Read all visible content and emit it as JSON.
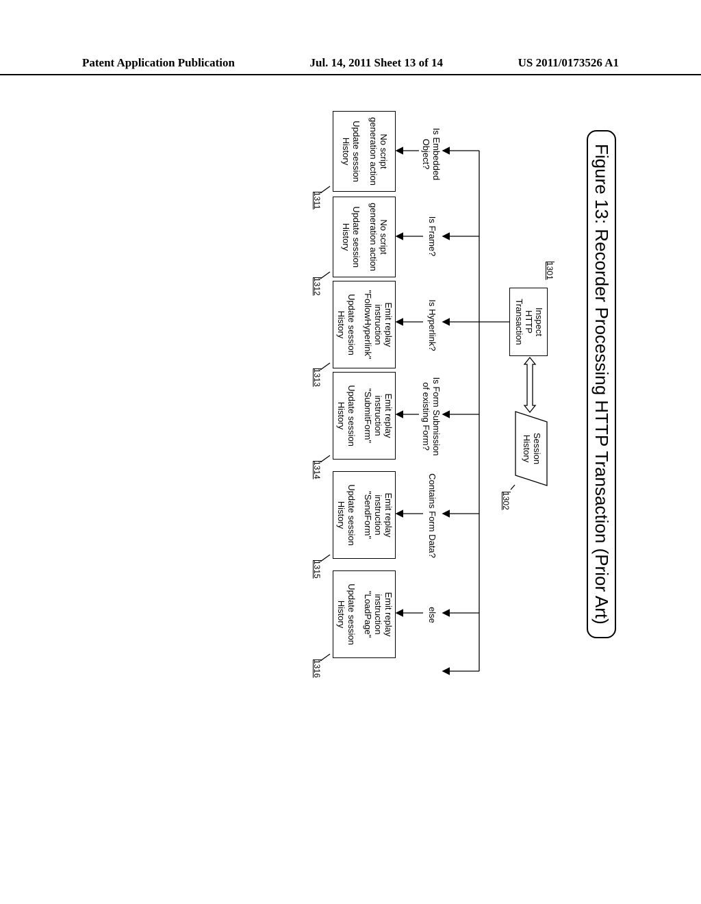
{
  "header": {
    "left": "Patent Application Publication",
    "center": "Jul. 14, 2011  Sheet 13 of 14",
    "right": "US 2011/0173526 A1"
  },
  "title": "Figure 13: Recorder Processing HTTP Transaction (Prior Art)",
  "inspect": {
    "l1": "Inspect",
    "l2": "HTTP",
    "l3": "Transaction"
  },
  "session": {
    "l1": "Session",
    "l2": "History"
  },
  "refs": {
    "r1301": "1301",
    "r1302": "1302",
    "r1311": "1311",
    "r1312": "1312",
    "r1313": "1313",
    "r1314": "1314",
    "r1315": "1315",
    "r1316": "1316"
  },
  "branches": {
    "b1": {
      "q1": "Is Embedded",
      "q2": "Object?"
    },
    "b2": {
      "q1": "Is Frame?"
    },
    "b3": {
      "q1": "Is Hyperlink?"
    },
    "b4": {
      "q1": "Is Form Submission",
      "q2": "of existing Form?"
    },
    "b5": {
      "q1": "Contains Form Data?"
    },
    "b6": {
      "q1": "else"
    }
  },
  "actions": {
    "a1": {
      "l1": "No script",
      "l2": "generation action",
      "l3": "Update session",
      "l4": "History"
    },
    "a2": {
      "l1": "No script",
      "l2": "generation action",
      "l3": "Update session",
      "l4": "History"
    },
    "a3": {
      "l1": "Emit replay instruction",
      "l2": "\"FollowHyperlink\"",
      "l3": "Update session",
      "l4": "History"
    },
    "a4": {
      "l1": "Emit replay instruction",
      "l2": "\"SubmitForm\"",
      "l3": "Update session",
      "l4": "History"
    },
    "a5": {
      "l1": "Emit replay instruction",
      "l2": "\"SendForm\"",
      "l3": "Update session",
      "l4": "History"
    },
    "a6": {
      "l1": "Emit replay instruction",
      "l2": "\"LoadPage\"",
      "l3": "Update session",
      "l4": "History"
    }
  }
}
